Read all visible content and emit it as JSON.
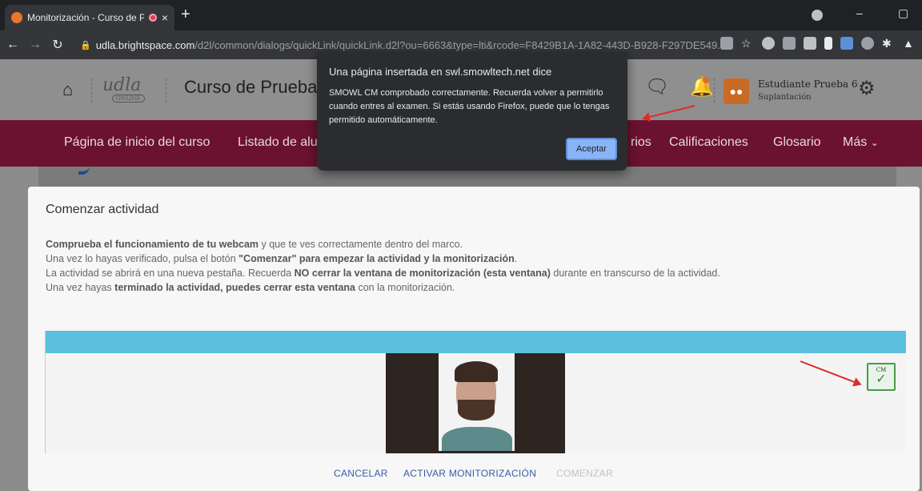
{
  "browser": {
    "tab_title": "Monitorización - Curso de P",
    "tab_close": "×",
    "new_tab": "+",
    "url_host": "udla.brightspace.com",
    "url_path": "/d2l/common/dialogs/quickLink/quickLink.d2l?ou=6663&type=lti&rcode=F8429B1A-1A82-443D-B928-F297DE549...",
    "minimize": "–",
    "maximize": "▢"
  },
  "header": {
    "course_title": "Curso de Prueba V",
    "user_name": "Estudiante Prueba 6",
    "user_role": "Suplantación",
    "logo_text": "udla",
    "logo_sub": "ONLINE"
  },
  "nav": {
    "items": [
      "Página de inicio del curso",
      "Listado de alu",
      "rios",
      "Calificaciones",
      "Glosario",
      "Más"
    ]
  },
  "dialog": {
    "title": "Una página insertada en swl.smowltech.net dice",
    "message": "SMOWL CM comprobado correctamente. Recuerda volver a permitirlo cuando entres al examen. Si estás usando Firefox, puede que lo tengas permitido automáticamente.",
    "accept_label": "Aceptar"
  },
  "activity": {
    "title": "Comenzar actividad",
    "line1_bold": "Comprueba el funcionamiento de tu webcam",
    "line1_rest": " y que te ves correctamente dentro del marco.",
    "line2_pre": "Una vez lo hayas verificado, pulsa el botón ",
    "line2_bold": "\"Comenzar\" para empezar la actividad y la monitorización",
    "line2_post": ".",
    "line3_pre": "La actividad se abrirá en una nueva pestaña. Recuerda ",
    "line3_bold": "NO cerrar la ventana de monitorización (esta ventana)",
    "line3_post": " durante en transcurso de la actividad.",
    "line4_pre": "Una vez hayas ",
    "line4_bold": "terminado la actividad, puedes cerrar esta ventana",
    "line4_post": " con la monitorización.",
    "cm_badge_text": "CM",
    "cm_check": "✓",
    "cancel_label": "CANCELAR",
    "activate_label": "ACTIVAR MONITORIZACIÓN",
    "start_label": "COMENZAR"
  },
  "colors": {
    "nav_bg": "#6b1230",
    "cam_bar": "#5bc0de",
    "arrow": "#e12a2a",
    "dialog_button": "#8ab4f8"
  }
}
